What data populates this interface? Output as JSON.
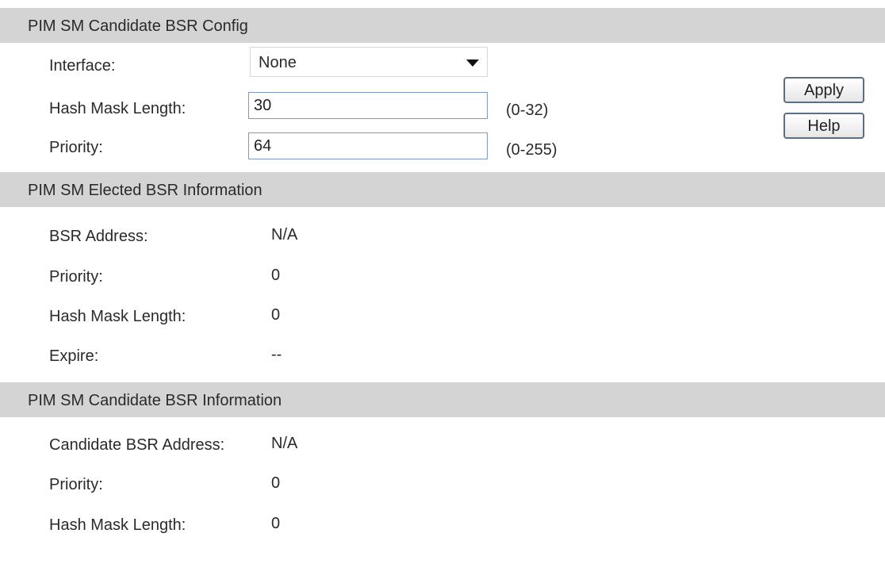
{
  "candidate_config": {
    "header": "PIM SM Candidate BSR Config",
    "interface_label": "Interface:",
    "interface_value": "None",
    "hash_mask_label": "Hash Mask Length:",
    "hash_mask_value": "30",
    "hash_mask_range": "(0-32)",
    "priority_label": "Priority:",
    "priority_value": "64",
    "priority_range": "(0-255)",
    "apply_label": "Apply",
    "help_label": "Help"
  },
  "elected_info": {
    "header": "PIM SM Elected BSR Information",
    "rows": [
      {
        "label": "BSR Address:",
        "value": "N/A"
      },
      {
        "label": "Priority:",
        "value": "0"
      },
      {
        "label": "Hash Mask Length:",
        "value": "0"
      },
      {
        "label": "Expire:",
        "value": "--"
      }
    ]
  },
  "candidate_info": {
    "header": "PIM SM Candidate BSR Information",
    "rows": [
      {
        "label": "Candidate BSR Address:",
        "value": "N/A"
      },
      {
        "label": "Priority:",
        "value": "0"
      },
      {
        "label": "Hash Mask Length:",
        "value": "0"
      }
    ]
  }
}
